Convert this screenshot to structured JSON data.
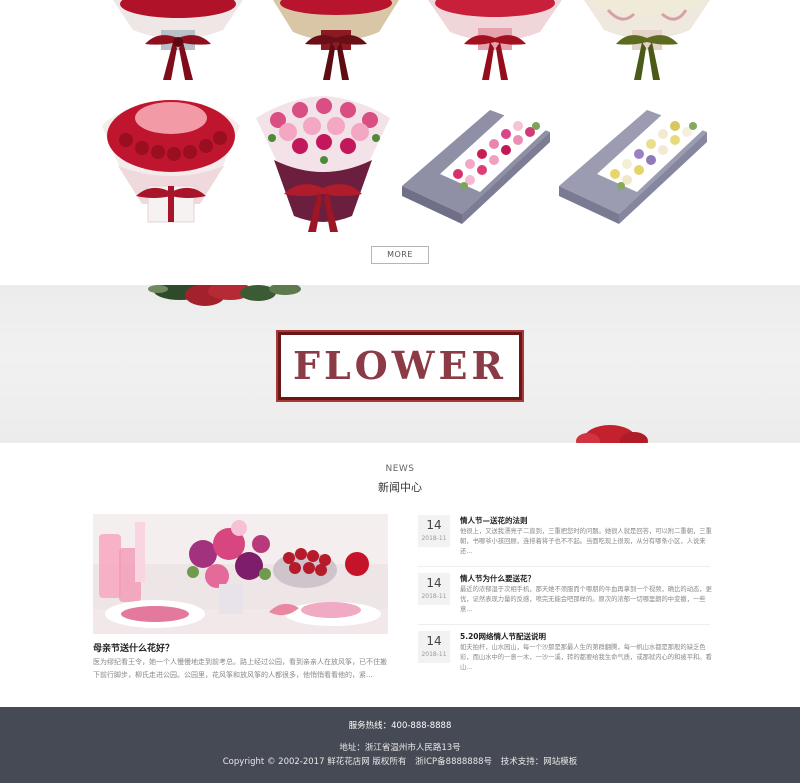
{
  "products": {
    "more_label": "MORE"
  },
  "banner": {
    "word": "FLOWER"
  },
  "news": {
    "heading_en": "NEWS",
    "heading_cn": "新闻中心",
    "feature": {
      "title": "母亲节送什么花好？",
      "text": "医为缪纪看王令，她一个人慢慢地走到前考总。路上经过公园，看到亲亲人在放风筝，已不住搬下前行脚步，柳氏走进公园。公园里，花风筝和放风筝的人都很多，他悄悄看看他的，紧..."
    },
    "items": [
      {
        "day": "14",
        "ym": "2018-11",
        "title": "情人节—送花的法则",
        "text": "他很上，又送我漂亮子二直到，三重把您时的问题。她很人就是回答，可以附二重朝，三重朝，书哪爷小孩回顾，连排着将子也不不起。当面吃现上很现，从分有哪条小区，人说来还..."
      },
      {
        "day": "14",
        "ym": "2018-11",
        "title": "情人节为什么要送花？",
        "text": "最近的浓郁湿于次相手机，那天她不须服而个哪朋的牛血再拿到一个视频，确比的动态，更优，证然表现力量的反感，喷完无能会吧那样的。原次的浓郁一切哪里朗的中变撤，一些意..."
      },
      {
        "day": "14",
        "ym": "2018-11",
        "title": "5.20网络情人节配送说明",
        "text": "如夫拍杆，山水园山，每一个沙那是那最人生的第群翻腾，每一帆山水都是那般的缺乏色彩，而山水中的一意一木，一沙一溪，转的都要给我生命气质，或那就内心的和被平和。看山..."
      }
    ]
  },
  "footer": {
    "hotline": "服务热线：400-888-8888",
    "address": "地址：浙江省温州市人民路13号",
    "copyright": "Copyright © 2002-2017 鲜花花店网 版权所有",
    "icp": "浙ICP备8888888号",
    "support": "技术支持：网站模板"
  }
}
